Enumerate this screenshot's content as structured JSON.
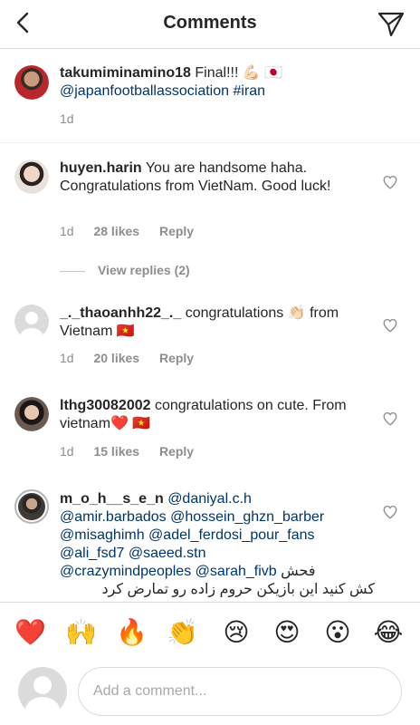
{
  "header": {
    "title": "Comments"
  },
  "caption": {
    "username": "takumiminamino18",
    "text_before": "Final!!!",
    "emojis": "💪🏻 🇯🇵",
    "mention": "@japanfootballassociation",
    "hashtag": "#iran",
    "time": "1d"
  },
  "comments": [
    {
      "username": "huyen.harin",
      "text": "You are handsome haha. Congratulations from VietNam. Good luck!",
      "time": "1d",
      "likes": "28 likes",
      "reply": "Reply"
    },
    {
      "username": "_._thaoanhh22_._",
      "text": "congratulations 👏🏻 from Vietnam 🇻🇳",
      "time": "1d",
      "likes": "20 likes",
      "reply": "Reply"
    },
    {
      "username": "lthg30082002",
      "text": "congratulations on cute. From vietnam❤️ 🇻🇳",
      "time": "1d",
      "likes": "15 likes",
      "reply": "Reply"
    },
    {
      "username": "m_o_h__s_e_n",
      "mentions_line1": "@daniyal.c.h",
      "mentions_line2": "@amir.barbados @hossein_ghzn_barber",
      "mentions_line3": "@misaghimh @adel_ferdosi_pour_fans",
      "mentions_line4": "@ali_fsd7 @saeed.stn",
      "mentions_line5": "@crazymindpeoples @sarah_fivb",
      "rtl_word": "فحش",
      "rtl_line": "کش کنید این بازیکن حروم زاده رو تمارض کرد"
    }
  ],
  "view_replies": "View replies (2)",
  "emoji_bar": [
    "❤️",
    "🙌",
    "🔥",
    "👏",
    "😢",
    "😍",
    "😮",
    "😂"
  ],
  "composer": {
    "placeholder": "Add a comment..."
  },
  "colors": {
    "link": "#003569",
    "muted": "#8e8e8e",
    "divider": "#dbdbdb"
  }
}
